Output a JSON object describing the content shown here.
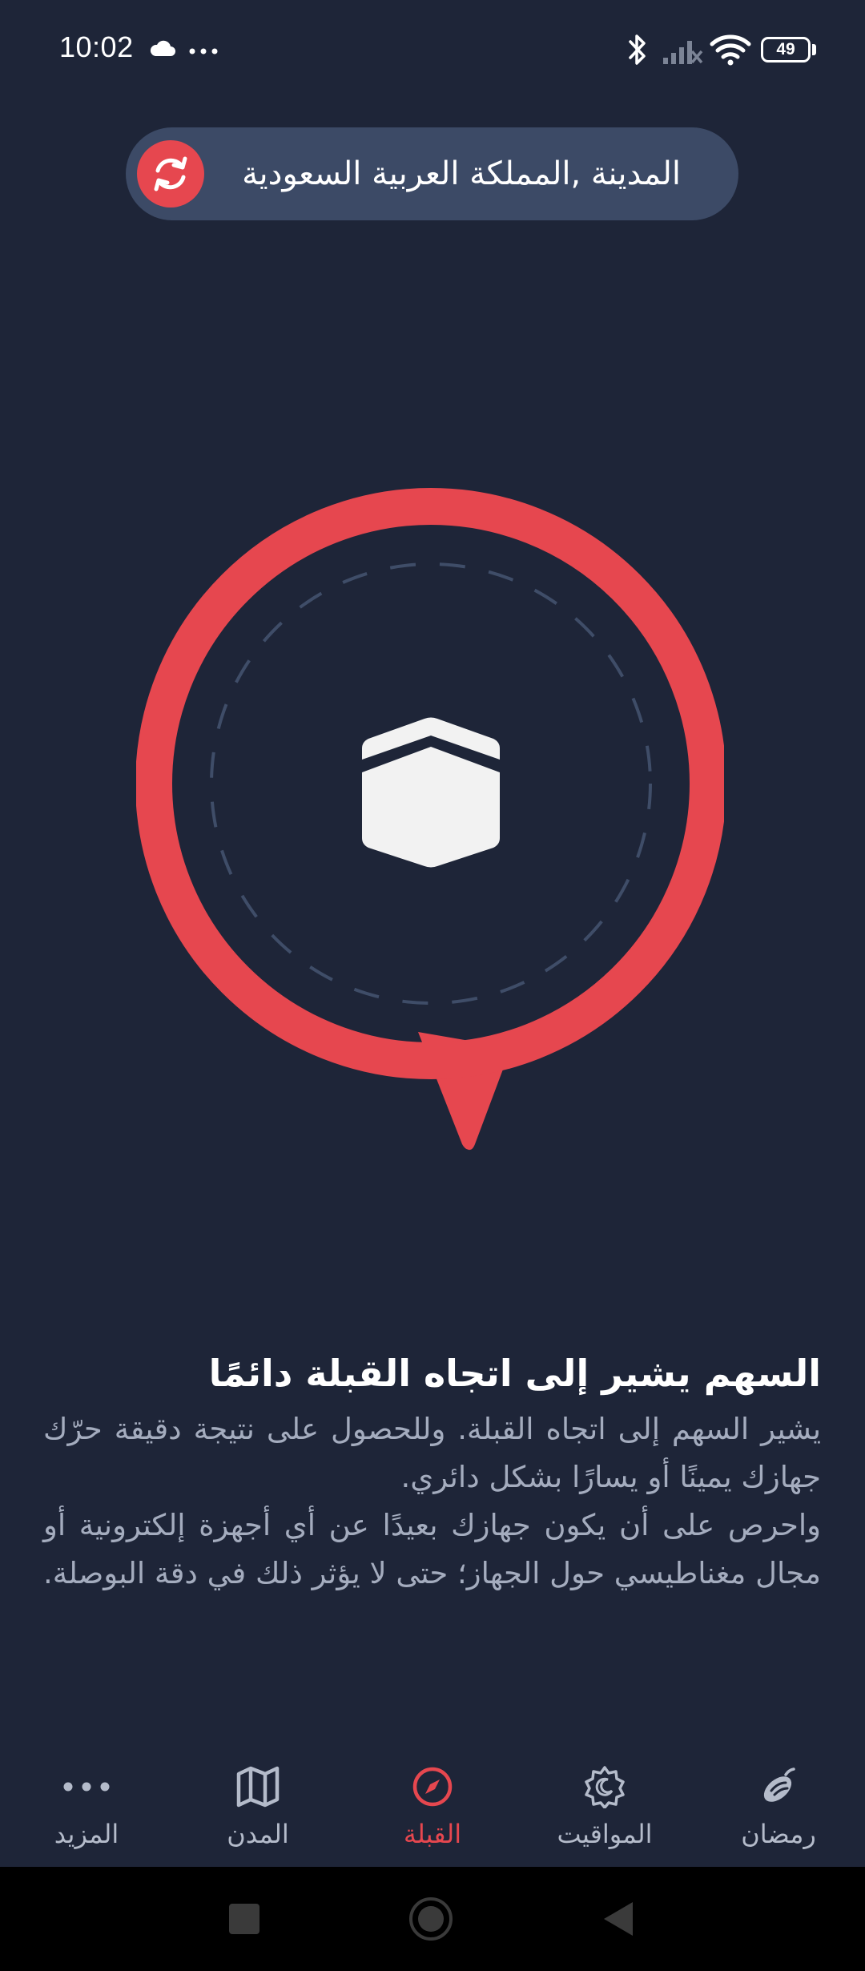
{
  "status_bar": {
    "time": "10:02",
    "icons": [
      "cloud-icon",
      "more-dots-icon",
      "bluetooth-icon",
      "signal-off-icon",
      "wifi-icon",
      "battery-icon"
    ],
    "battery": "49"
  },
  "location": {
    "label": "المدينة ,المملكة العربية السعودية",
    "refresh_icon": "refresh-icon"
  },
  "compass": {
    "center_icon": "kaaba-icon",
    "ring_color": "#e6474f",
    "dashed_color": "#3f4d68"
  },
  "info": {
    "title": "السهم يشير إلى اتجاه القبلة دائمًا",
    "paragraph1": "يشير السهم إلى اتجاه القبلة. وللحصول على نتيجة دقيقة حرّك جهازك يمينًا أو يسارًا بشكل دائري.",
    "paragraph2": "واحرص على أن يكون جهازك بعيدًا عن أي أجهزة إلكترونية أو مجال مغناطيسي حول الجهاز؛ حتى لا يؤثر ذلك في دقة البوصلة."
  },
  "bottom_nav": {
    "items": [
      {
        "label": "المزيد",
        "icon": "more-icon",
        "active": false
      },
      {
        "label": "المدن",
        "icon": "map-icon",
        "active": false
      },
      {
        "label": "القبلة",
        "icon": "compass-icon",
        "active": true
      },
      {
        "label": "المواقيت",
        "icon": "crescent-icon",
        "active": false
      },
      {
        "label": "رمضان",
        "icon": "dates-icon",
        "active": false
      }
    ],
    "active_color": "#e6474f",
    "inactive_color": "#b4bbca"
  },
  "system_nav": {
    "buttons": [
      "recent-apps-button",
      "home-button",
      "back-button"
    ]
  }
}
